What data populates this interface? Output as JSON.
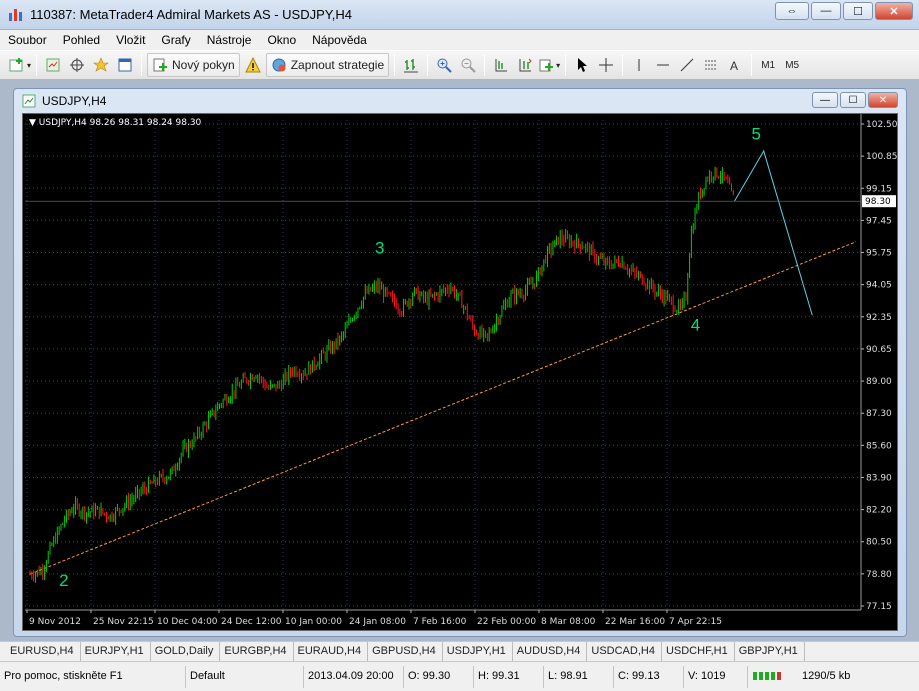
{
  "window": {
    "title": "110387: MetaTrader4 Admiral Markets AS - USDJPY,H4",
    "minimize": "—",
    "maximize": "☐",
    "close": "✕",
    "restore": "⇔"
  },
  "menu": [
    "Soubor",
    "Pohled",
    "Vložit",
    "Grafy",
    "Nástroje",
    "Okno",
    "Nápověda"
  ],
  "toolbar": {
    "new_order_label": "Nový pokyn",
    "autotrading_label": "Zapnout strategie",
    "timeframes": [
      "M1",
      "M5"
    ]
  },
  "chart_window": {
    "title": "USDJPY,H4",
    "info_text": "USDJPY,H4  98.26 98.31 98.24 98.30"
  },
  "chart_data": {
    "type": "candlestick",
    "symbol": "USDJPY",
    "timeframe": "H4",
    "current_price": "98.30",
    "y_ticks": [
      "102.50",
      "100.85",
      "99.15",
      "97.45",
      "95.75",
      "94.05",
      "92.35",
      "90.65",
      "89.00",
      "87.30",
      "85.60",
      "83.90",
      "82.20",
      "80.50",
      "78.80",
      "77.15"
    ],
    "x_ticks": [
      "9 Nov 2012",
      "25 Nov 22:15",
      "10 Dec 04:00",
      "24 Dec 12:00",
      "10 Jan 00:00",
      "24 Jan 08:00",
      "7 Feb 16:00",
      "22 Feb 00:00",
      "8 Mar 08:00",
      "22 Mar 16:00",
      "7 Apr 22:15"
    ],
    "ylim": [
      77.15,
      102.5
    ],
    "price_path": [
      [
        0,
        79.0
      ],
      [
        5,
        79.2
      ],
      [
        9,
        80.5
      ],
      [
        14,
        81.8
      ],
      [
        18,
        82.5
      ],
      [
        23,
        82.2
      ],
      [
        28,
        82.3
      ],
      [
        33,
        82.0
      ],
      [
        38,
        82.5
      ],
      [
        43,
        83.0
      ],
      [
        48,
        83.5
      ],
      [
        53,
        83.9
      ],
      [
        58,
        84.2
      ],
      [
        63,
        85.4
      ],
      [
        68,
        86.0
      ],
      [
        73,
        86.9
      ],
      [
        78,
        87.8
      ],
      [
        83,
        88.4
      ],
      [
        88,
        89.0
      ],
      [
        93,
        89.4
      ],
      [
        98,
        88.6
      ],
      [
        103,
        88.8
      ],
      [
        108,
        89.6
      ],
      [
        113,
        89.4
      ],
      [
        118,
        90.0
      ],
      [
        123,
        90.6
      ],
      [
        128,
        91.2
      ],
      [
        133,
        92.4
      ],
      [
        138,
        93.5
      ],
      [
        143,
        93.9
      ],
      [
        148,
        93.3
      ],
      [
        153,
        92.7
      ],
      [
        158,
        93.6
      ],
      [
        163,
        93.2
      ],
      [
        168,
        93.5
      ],
      [
        173,
        93.9
      ],
      [
        178,
        93.0
      ],
      [
        183,
        91.6
      ],
      [
        188,
        91.2
      ],
      [
        193,
        92.4
      ],
      [
        198,
        93.4
      ],
      [
        203,
        93.6
      ],
      [
        208,
        94.2
      ],
      [
        213,
        95.6
      ],
      [
        218,
        96.4
      ],
      [
        223,
        96.2
      ],
      [
        228,
        96.0
      ],
      [
        233,
        95.4
      ],
      [
        238,
        95.0
      ],
      [
        243,
        95.2
      ],
      [
        248,
        94.6
      ],
      [
        253,
        94.2
      ],
      [
        258,
        93.6
      ],
      [
        262,
        93.3
      ],
      [
        266,
        92.8
      ],
      [
        268,
        92.7
      ],
      [
        270,
        93.4
      ],
      [
        272,
        96.5
      ],
      [
        275,
        98.4
      ],
      [
        278,
        99.4
      ],
      [
        281,
        99.8
      ],
      [
        284,
        99.7
      ],
      [
        287,
        99.2
      ],
      [
        290,
        98.3
      ]
    ],
    "trendline": {
      "from": [
        "9 Nov 2012",
        79.0
      ],
      "to_after": [
        "7 Apr 22:15",
        96.2
      ]
    },
    "wave_labels": [
      {
        "label": "2",
        "color": "#00e07a"
      },
      {
        "label": "3",
        "color": "#00e07a"
      },
      {
        "label": "4",
        "color": "#00e07a"
      },
      {
        "label": "5",
        "color": "#00e07a"
      }
    ],
    "projection": {
      "points": [
        [
          290,
          98.3
        ],
        [
          302,
          100.9
        ],
        [
          322,
          92.4
        ]
      ],
      "color": "#5fd0e6"
    },
    "colors": {
      "bull": "#00d000",
      "bear": "#ff1a1a",
      "grid": "#2b4760",
      "trend": "#ff9a2c",
      "label": "#00e07a"
    },
    "grid": true
  },
  "tabs": [
    "EURUSD,H4",
    "EURJPY,H1",
    "GOLD,Daily",
    "EURGBP,H4",
    "EURAUD,H4",
    "GBPUSD,H4",
    "USDJPY,H1",
    "AUDUSD,H4",
    "USDCAD,H4",
    "USDCHF,H1",
    "GBPJPY,H1"
  ],
  "status": {
    "help": "Pro pomoc, stiskněte F1",
    "profile": "Default",
    "datetime": "2013.04.09 20:00",
    "open": "O: 99.30",
    "high": "H: 99.31",
    "low": "L: 98.91",
    "close": "C: 99.13",
    "volume": "V: 1019",
    "traffic": "1290/5 kb"
  }
}
